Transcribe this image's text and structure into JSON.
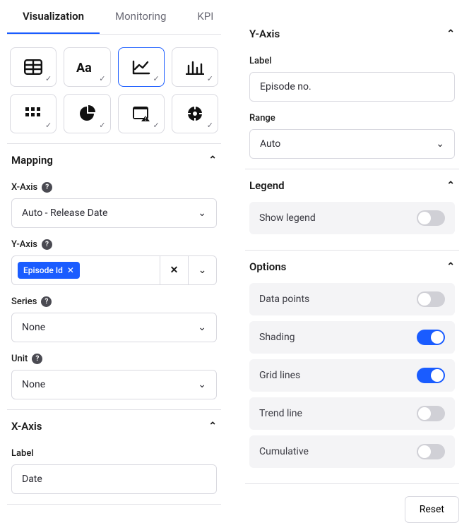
{
  "tabs": {
    "t0": "Visualization",
    "t1": "Monitoring",
    "t2": "KPI"
  },
  "mapping": {
    "title": "Mapping",
    "xaxis_label": "X-Axis",
    "xaxis_value": "Auto - Release Date",
    "yaxis_label": "Y-Axis",
    "yaxis_chip": "Episode Id",
    "series_label": "Series",
    "series_value": "None",
    "unit_label": "Unit",
    "unit_value": "None"
  },
  "xaxis": {
    "title": "X-Axis",
    "label_caption": "Label",
    "label_value": "Date"
  },
  "yaxis": {
    "title": "Y-Axis",
    "label_caption": "Label",
    "label_value": "Episode no.",
    "range_caption": "Range",
    "range_value": "Auto"
  },
  "legend": {
    "title": "Legend",
    "show_label": "Show legend",
    "show_on": false
  },
  "options": {
    "title": "Options",
    "datapoints": "Data points",
    "shading": "Shading",
    "gridlines": "Grid lines",
    "trendline": "Trend line",
    "cumulative": "Cumulative",
    "dp_on": false,
    "sh_on": true,
    "gl_on": true,
    "tl_on": false,
    "cu_on": false
  },
  "reset": "Reset"
}
